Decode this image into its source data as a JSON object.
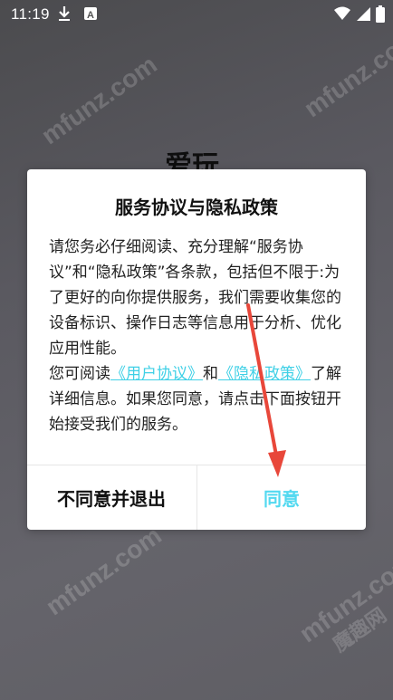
{
  "status_bar": {
    "time": "11:19",
    "icons": [
      "download-icon",
      "a-icon",
      "wifi-icon",
      "signal-icon",
      "battery-icon"
    ]
  },
  "background": {
    "logo_text": "爱玩",
    "watermarks": [
      "mfunz.com",
      "mfunz.com",
      "mfunz.com",
      "mfunz.com",
      "魔趣网"
    ]
  },
  "dialog": {
    "title": "服务协议与隐私政策",
    "body_intro": "请您务必仔细阅读、充分理解“服务协议”和“隐私政策”各条款，包括但不限于:为了更好的向你提供服务，我们需要收集您的设备标识、操作日志等信息用于分析、优化应用性能。",
    "body_read_prefix": "您可阅读",
    "link_user_agreement": "《用户协议》",
    "and_text": "和",
    "link_privacy_policy": "《隐私政策》",
    "body_suffix": "了解详细信息。如果您同意，请点击下面按钮开始接受我们的服务。",
    "disagree_label": "不同意并退出",
    "agree_label": "同意"
  },
  "colors": {
    "link": "#3fd0e6",
    "agree": "#53d9f0",
    "annotation_arrow": "#e8473a"
  }
}
